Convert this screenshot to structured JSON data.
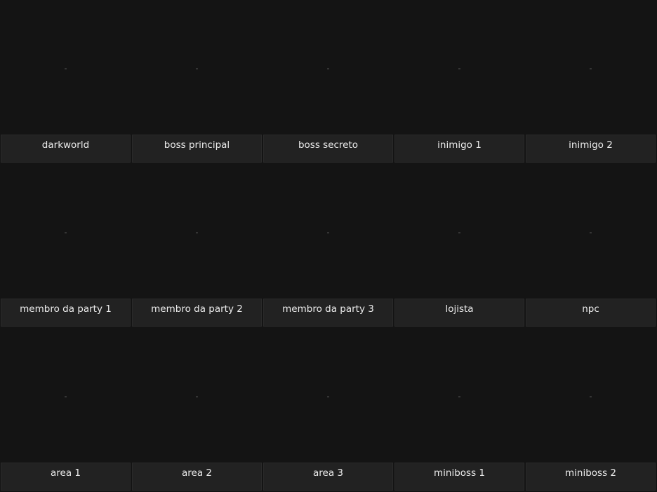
{
  "tiles": [
    {
      "label": "darkworld",
      "placeholder": "-"
    },
    {
      "label": "boss principal",
      "placeholder": "-"
    },
    {
      "label": "boss secreto",
      "placeholder": "-"
    },
    {
      "label": "inimigo 1",
      "placeholder": "-"
    },
    {
      "label": "inimigo 2",
      "placeholder": "-"
    },
    {
      "label": "membro da party 1",
      "placeholder": "-"
    },
    {
      "label": "membro da party 2",
      "placeholder": "-"
    },
    {
      "label": "membro da party 3",
      "placeholder": "-"
    },
    {
      "label": "lojista",
      "placeholder": "-"
    },
    {
      "label": "npc",
      "placeholder": "-"
    },
    {
      "label": "area 1",
      "placeholder": "-"
    },
    {
      "label": "area 2",
      "placeholder": "-"
    },
    {
      "label": "area 3",
      "placeholder": "-"
    },
    {
      "label": "miniboss 1",
      "placeholder": "-"
    },
    {
      "label": "miniboss 2",
      "placeholder": "-"
    }
  ],
  "colors": {
    "background": "#141414",
    "label_bar": "#222222",
    "label_text": "#ececec",
    "placeholder_text": "#6a6a6a"
  }
}
